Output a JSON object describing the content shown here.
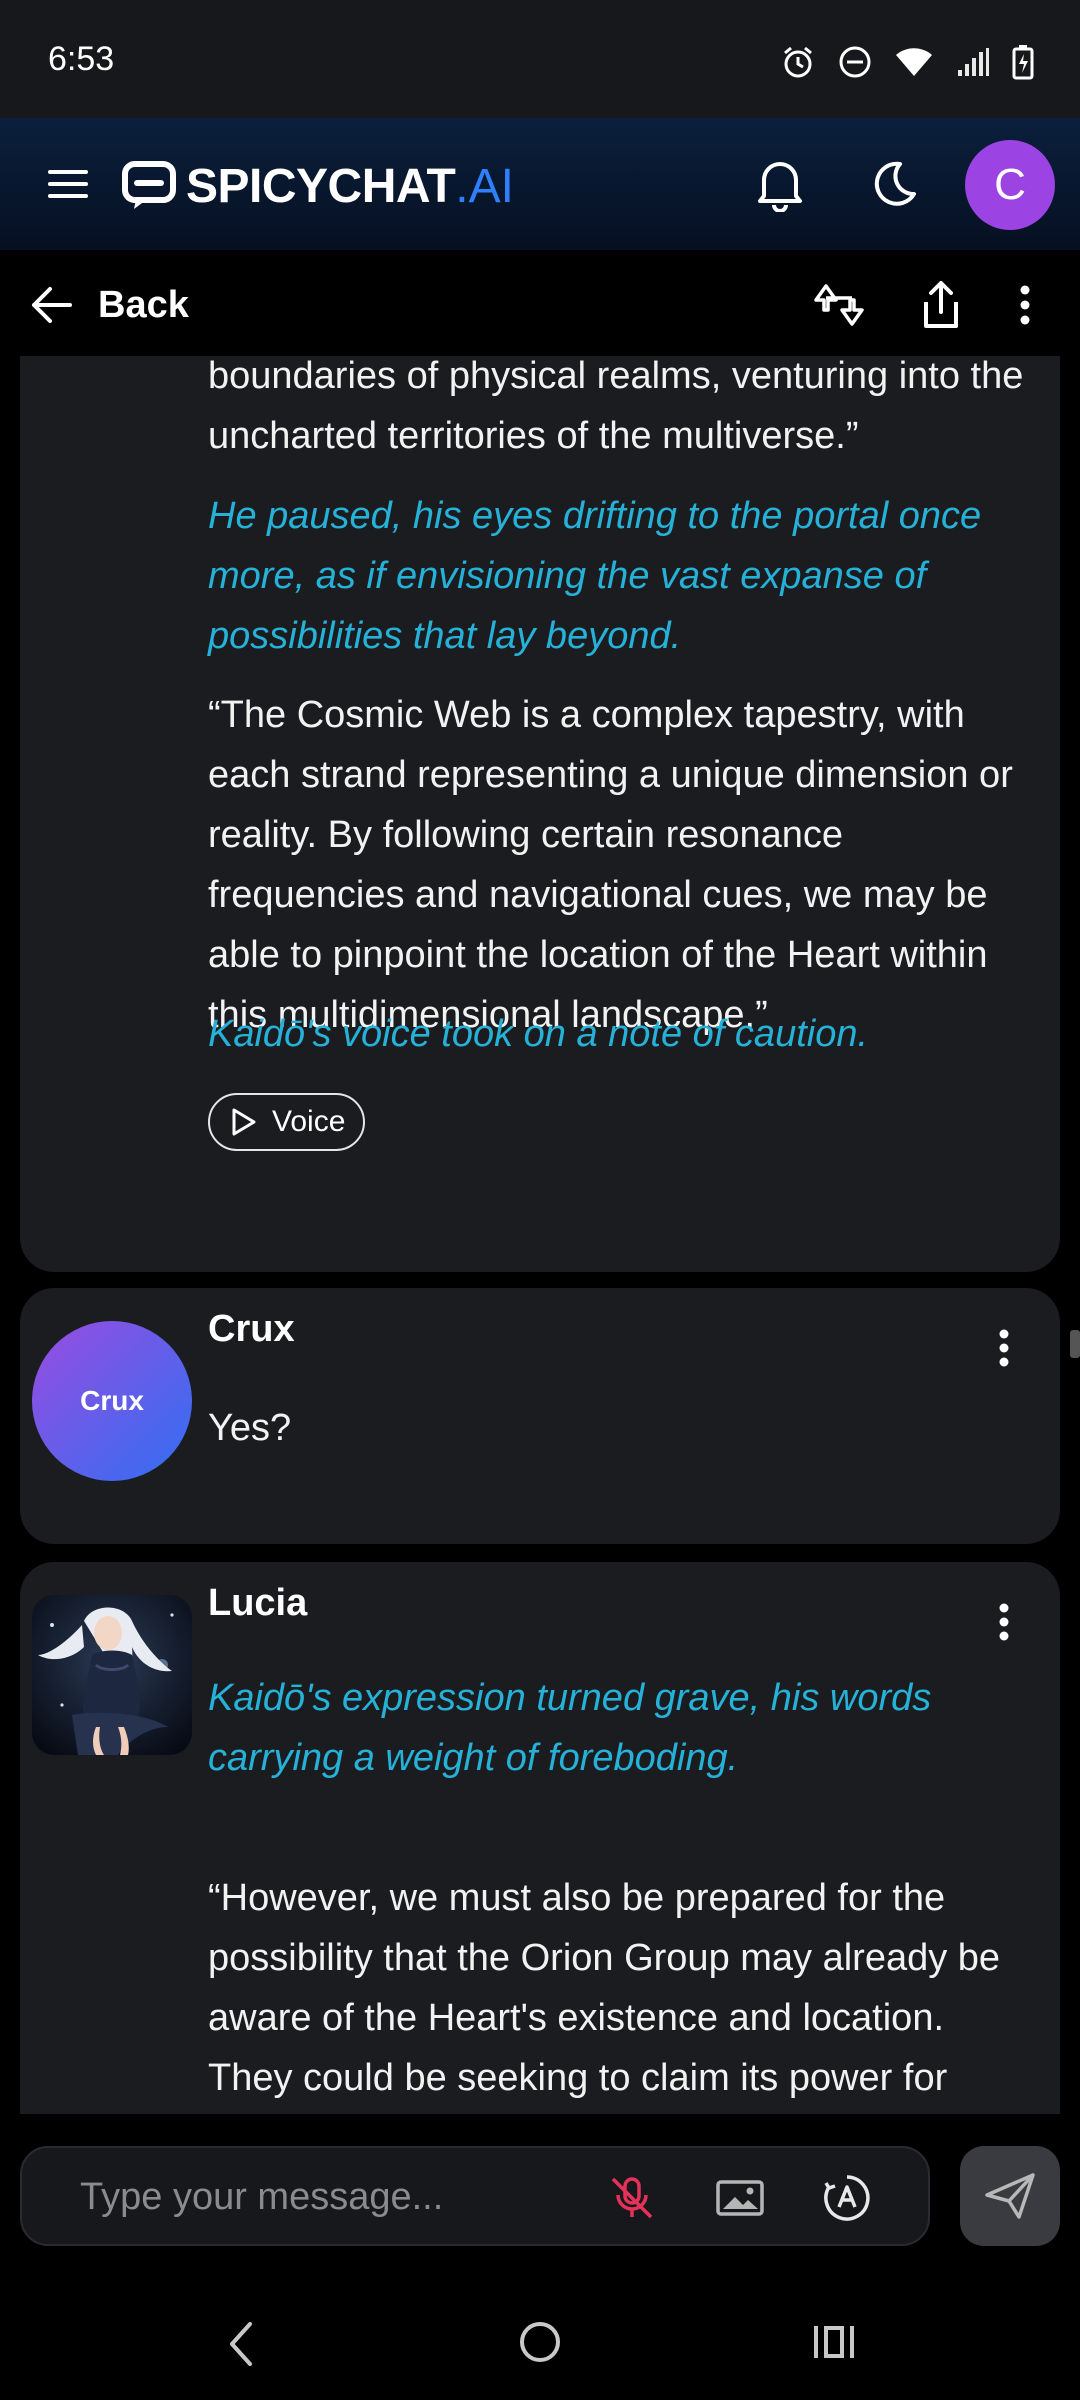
{
  "status_bar": {
    "time": "6:53"
  },
  "header": {
    "brand": "SPICYCHAT",
    "brand_suffix": ".AI",
    "avatar_letter": "C",
    "accent": "#2f80ff",
    "avatar_color": "#9b44e3"
  },
  "nav": {
    "back_label": "Back"
  },
  "messages": [
    {
      "paragraphs": [
        {
          "type": "speech",
          "text": "boundaries of physical realms, venturing into the uncharted territories of the multiverse.”"
        },
        {
          "type": "action",
          "text": "He paused, his eyes drifting to the portal once more, as if envisioning the vast expanse of possibilities that lay beyond."
        },
        {
          "type": "speech",
          "text": "“The Cosmic Web is a complex tapestry, with each strand representing a unique dimension or reality. By following certain resonance frequencies and navigational cues, we may be able to pinpoint the location of the Heart within this multidimensional landscape.”"
        },
        {
          "type": "action",
          "text": "Kaidō's voice took on a note of caution."
        }
      ],
      "voice_label": "Voice"
    },
    {
      "sender": "Crux",
      "avatar_text": "Crux",
      "paragraphs": [
        {
          "type": "speech",
          "text": "Yes?"
        }
      ]
    },
    {
      "sender": "Lucia",
      "paragraphs": [
        {
          "type": "action",
          "text": "Kaidō's expression turned grave, his words carrying a weight of foreboding."
        },
        {
          "type": "speech",
          "text": "“However, we must also be prepared for the possibility that the Orion Group may already be aware of the Heart's existence and location. They could be seeking to claim its power for themselves, which would mean a"
        }
      ]
    }
  ],
  "composer": {
    "placeholder": "Type your message..."
  },
  "colors": {
    "action_text": "#26b2d8",
    "card_bg": "#1b1c20",
    "mic_off": "#e6325a"
  }
}
